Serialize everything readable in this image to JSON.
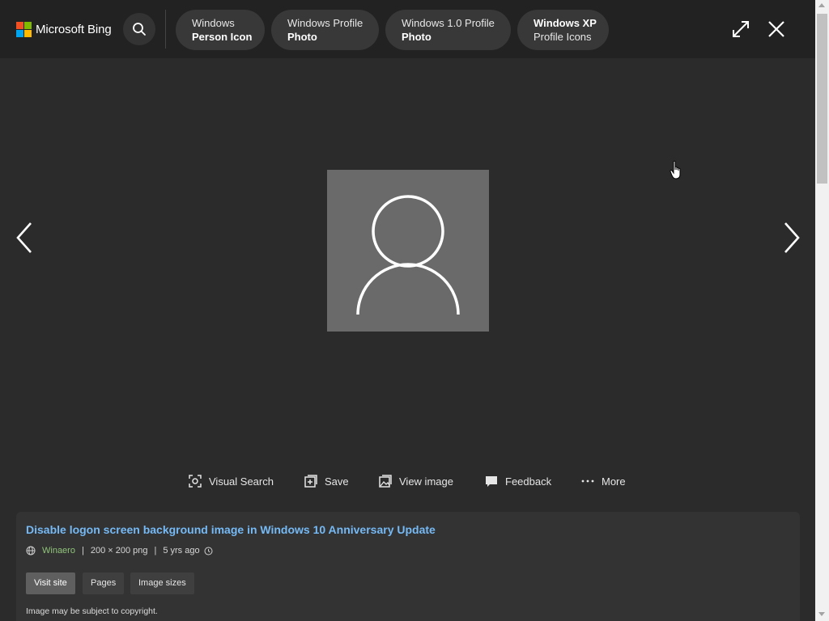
{
  "header": {
    "brand": "Microsoft Bing",
    "logo_colors": [
      "#f25022",
      "#7fba00",
      "#00a4ef",
      "#ffb900"
    ],
    "search_icon": "search-icon",
    "chips": [
      {
        "line1": "Windows",
        "line2": "Person Icon"
      },
      {
        "line1": "Windows Profile",
        "line2": "Photo"
      },
      {
        "line1": "Windows 1.0 Profile",
        "line2": "Photo"
      },
      {
        "line1": "Windows XP",
        "line2": "Profile Icons"
      }
    ],
    "expand_icon": "expand-icon",
    "close_icon": "close-icon"
  },
  "viewer": {
    "prev_icon": "chevron-left-icon",
    "next_icon": "chevron-right-icon",
    "image_icon": "person-silhouette-icon",
    "image_bg": "#6a6a6a"
  },
  "actions": [
    {
      "label": "Visual Search",
      "icon": "visual-search-icon"
    },
    {
      "label": "Save",
      "icon": "save-icon"
    },
    {
      "label": "View image",
      "icon": "view-image-icon"
    },
    {
      "label": "Feedback",
      "icon": "feedback-icon"
    },
    {
      "label": "More",
      "icon": "more-icon"
    }
  ],
  "card": {
    "title": "Disable logon screen background image in Windows 10 Anniversary Update",
    "source": "Winaero",
    "sep1": "|",
    "dimensions": "200 × 200 png",
    "sep2": "|",
    "age": "5 yrs ago",
    "buttons": {
      "visit": "Visit site",
      "pages": "Pages",
      "sizes": "Image sizes"
    },
    "copyright": "Image may be subject to copyright."
  },
  "colors": {
    "title_link": "#75b9f5",
    "source_link": "#8fc47a",
    "background": "#2b2b2b",
    "header_bg": "#222222"
  }
}
